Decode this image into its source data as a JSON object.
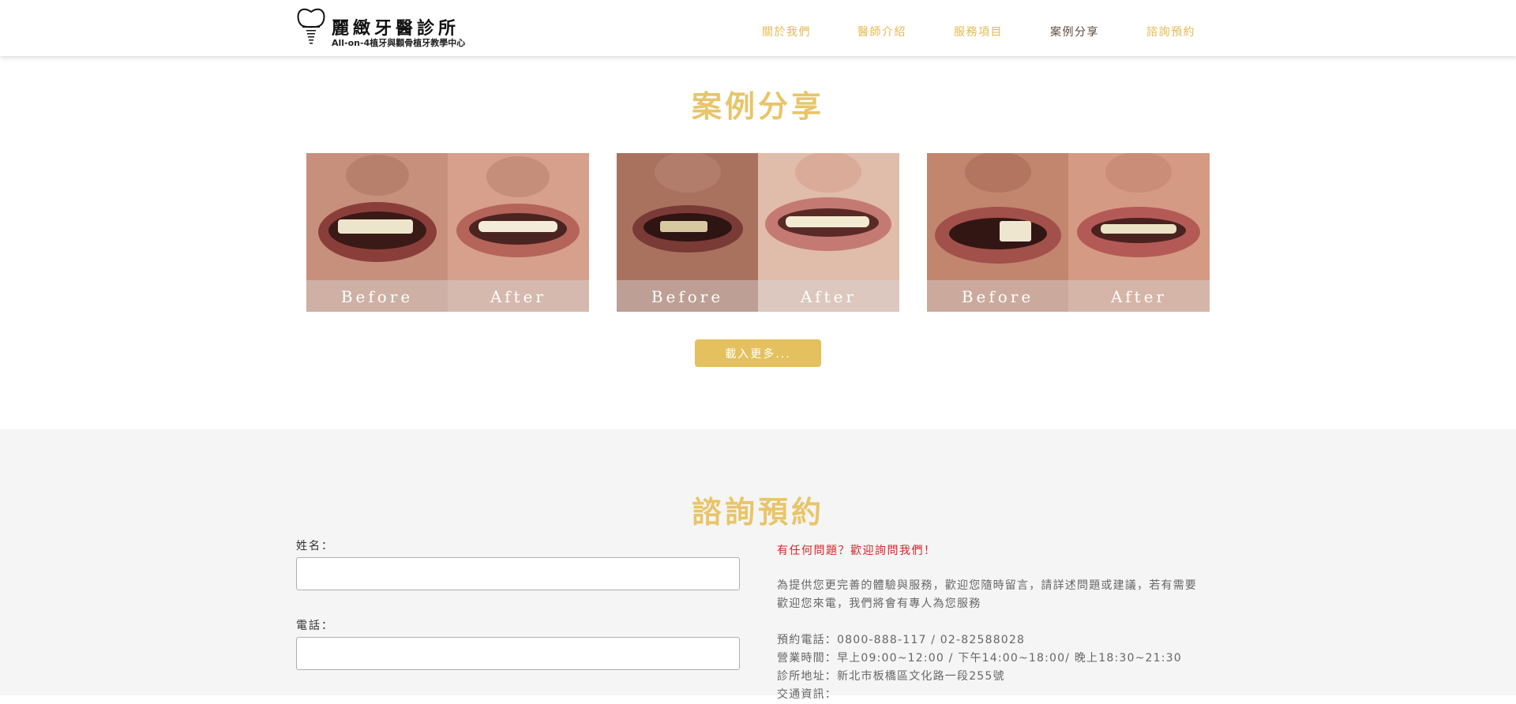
{
  "header": {
    "logo_name": "麗緻牙醫診所",
    "logo_subtitle": "All-on-4植牙與顴骨植牙教學中心",
    "nav": [
      {
        "label": "關於我們",
        "active": false
      },
      {
        "label": "醫師介紹",
        "active": false
      },
      {
        "label": "服務項目",
        "active": false
      },
      {
        "label": "案例分享",
        "active": true
      },
      {
        "label": "諮詢預約",
        "active": false
      }
    ]
  },
  "cases": {
    "title": "案例分享",
    "items": [
      {
        "before_label": "Before",
        "after_label": "After"
      },
      {
        "before_label": "Before",
        "after_label": "After"
      },
      {
        "before_label": "Before",
        "after_label": "After"
      }
    ],
    "load_more_label": "載入更多..."
  },
  "contact": {
    "title": "諮詢預約",
    "form": {
      "name_label": "姓名：",
      "name_value": "",
      "phone_label": "電話：",
      "phone_value": ""
    },
    "question": "有任何問題？歡迎詢問我們！",
    "intro_line1": "為提供您更完善的體驗與服務，歡迎您隨時留言，請詳述問題或建議，若有需要",
    "intro_line2": "歡迎您來電，我們將會有專人為您服務",
    "phone_line": "預約電話：0800-888-117 / 02-82588028",
    "hours_line": "營業時間：早上09:00~12:00 / 下午14:00~18:00/ 晚上18:30~21:30",
    "address_line": "診所地址：新北市板橋區文化路一段255號",
    "traffic_line": "交通資訊："
  },
  "colors": {
    "accent_gold": "#e4bb52",
    "title_gold": "#e8c56a",
    "button_gold": "#e4c15e",
    "question_red": "#d8232a",
    "nav_active": "#5a4a3a",
    "contact_bg": "#f5f5f5"
  }
}
